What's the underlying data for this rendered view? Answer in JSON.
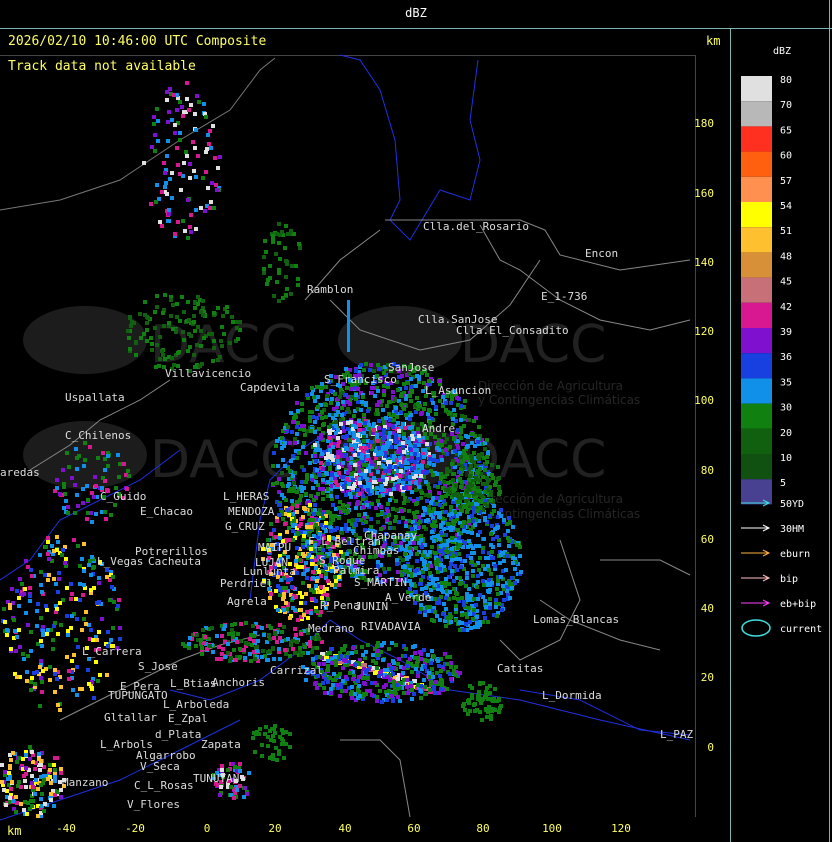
{
  "header": {
    "title": "dBZ"
  },
  "map": {
    "timestamp": "2026/02/10 10:46:00 UTC Composite",
    "track_notice": "Track data not available",
    "km_label_right": "km",
    "km_label_bottom": "km",
    "x_ticks": [
      "-40",
      "-20",
      "0",
      "20",
      "40",
      "60",
      "80",
      "100",
      "120"
    ],
    "y_ticks": [
      "180",
      "160",
      "140",
      "120",
      "100",
      "80",
      "60",
      "40",
      "20",
      "0"
    ],
    "places": [
      "Clla.del_Rosario",
      "Encon",
      "E_1-736",
      "Ramblon",
      "Clla.SanJose",
      "Clla.El_Consadito",
      "S_Francisco",
      "SanJose",
      "L_Asuncion",
      "Villavicencio",
      "Capdevila",
      "Uspallata",
      "C_Chilenos",
      "aredas",
      "C_Guido",
      "E_Chacao",
      "L_HERAS",
      "MENDOZA",
      "G_CRUZ",
      "MAIPU",
      "LUJAN",
      "Lunlunta",
      "Potrerillos",
      "L_Vegas",
      "Cacheuta",
      "Perdriel",
      "Agrela",
      "F_L_Beltran",
      "Chimbas",
      "Chapanay",
      "S_Roque",
      "Palmira",
      "S_MARTIN",
      "JUNIN",
      "R_Pena",
      "A_Verde",
      "Medrano",
      "RIVADAVIA",
      "L_Carrera",
      "S_Jose",
      "L_Btias",
      "E_Pera",
      "TUPUNGATO",
      "Anchoris",
      "Carrizal",
      "L_Arboleda",
      "E_Zpal",
      "Gltallar",
      "L_Arbols",
      "d_Plata",
      "Zapata",
      "Algarrobo",
      "V_Seca",
      "TUNUYAN",
      "Manzano",
      "C_L_Rosas",
      "V_Flores",
      "Lomas_Blancas",
      "Catitas",
      "L_Dormida",
      "L_PAZ",
      "Andre"
    ],
    "watermark_brand": "DACC",
    "watermark_line1": "Dirección de Agricultura",
    "watermark_line2": "y Contingencias Climáticas"
  },
  "legend": {
    "title": "dBZ",
    "scale": [
      {
        "label": "80",
        "color": "#e0e0e0"
      },
      {
        "label": "70",
        "color": "#b8b8b8"
      },
      {
        "label": "65",
        "color": "#ff3020"
      },
      {
        "label": "60",
        "color": "#ff6010"
      },
      {
        "label": "57",
        "color": "#ff9050"
      },
      {
        "label": "54",
        "color": "#ffff00"
      },
      {
        "label": "51",
        "color": "#ffc030"
      },
      {
        "label": "48",
        "color": "#d89038"
      },
      {
        "label": "45",
        "color": "#c87078"
      },
      {
        "label": "42",
        "color": "#d81890"
      },
      {
        "label": "39",
        "color": "#8010d0"
      },
      {
        "label": "36",
        "color": "#1840e0"
      },
      {
        "label": "35",
        "color": "#1090e8"
      },
      {
        "label": "30",
        "color": "#108010"
      },
      {
        "label": "20",
        "color": "#106010"
      },
      {
        "label": "10",
        "color": "#105010"
      },
      {
        "label": "5",
        "color": "#484090"
      }
    ],
    "tracks": [
      {
        "label": "50YD",
        "color": "#40e0e0"
      },
      {
        "label": "30HM",
        "color": "#ffffff"
      },
      {
        "label": "eburn",
        "color": "#ffb040"
      },
      {
        "label": "bip",
        "color": "#ffc0c0"
      },
      {
        "label": "eb+bip",
        "color": "#ff40ff"
      }
    ],
    "current_label": "current",
    "current_color": "#40e0e0"
  }
}
